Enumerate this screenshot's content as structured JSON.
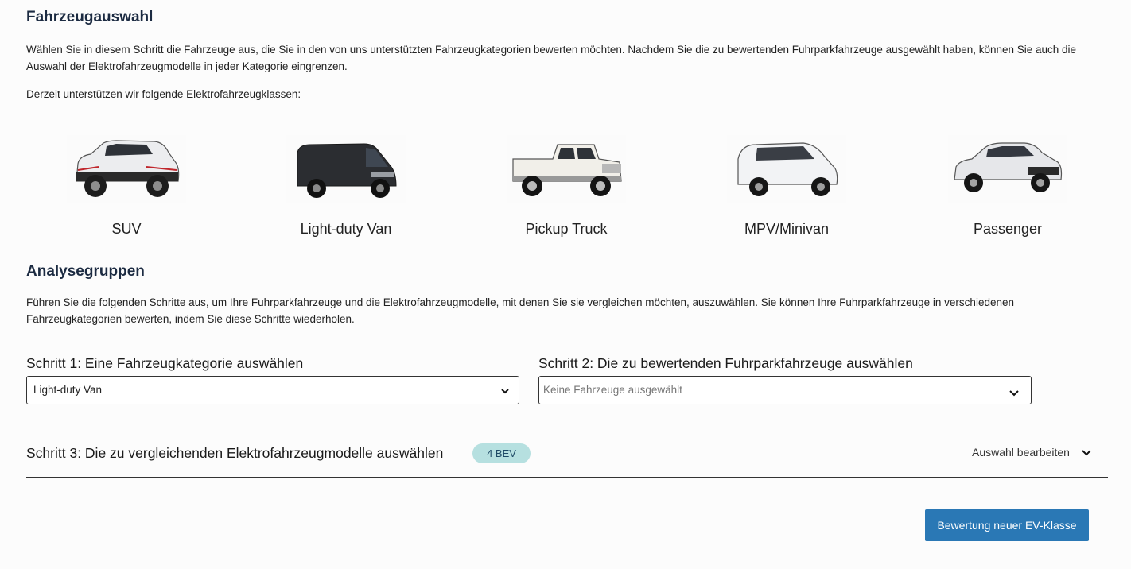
{
  "vehicle_selection": {
    "title": "Fahrzeugauswahl",
    "intro": "Wählen Sie in diesem Schritt die Fahrzeuge aus, die Sie in den von uns unterstützten Fahrzeugkategorien bewerten möchten. Nachdem Sie die zu bewertenden Fuhrparkfahrzeuge ausgewählt haben, können Sie auch die Auswahl der Elektrofahrzeugmodelle in jeder Kategorie eingrenzen.",
    "supported_text": "Derzeit unterstützen wir folgende Elektrofahrzeugklassen:",
    "classes": [
      {
        "label": "SUV",
        "icon": "suv-car-image"
      },
      {
        "label": "Light-duty Van",
        "icon": "van-image"
      },
      {
        "label": "Pickup Truck",
        "icon": "pickup-truck-image"
      },
      {
        "label": "MPV/Minivan",
        "icon": "minivan-image"
      },
      {
        "label": "Passenger",
        "icon": "sedan-image"
      }
    ]
  },
  "analysis_groups": {
    "title": "Analysegruppen",
    "intro": "Führen Sie die folgenden Schritte aus, um Ihre Fuhrparkfahrzeuge und die Elektrofahrzeugmodelle, mit denen Sie sie vergleichen möchten, auszuwählen. Sie können Ihre Fuhrparkfahrzeuge in verschiedenen Fahrzeugkategorien bewerten, indem Sie diese Schritte wiederholen.",
    "step1": {
      "label": "Schritt 1: Eine Fahrzeugkategorie auswählen",
      "value": "Light-duty Van"
    },
    "step2": {
      "label": "Schritt 2: Die zu bewertenden Fuhrparkfahrzeuge auswählen",
      "placeholder": "Keine Fahrzeuge ausgewählt"
    },
    "step3": {
      "label": "Schritt 3: Die zu vergleichenden Elektrofahrzeugmodelle auswählen",
      "badge": "4 BEV",
      "edit_label": "Auswahl bearbeiten"
    }
  },
  "actions": {
    "new_class_button": "Bewertung neuer EV-Klasse"
  },
  "colors": {
    "heading": "#1c2b42",
    "badge_bg": "#b6e0e0",
    "button_bg": "#2a78b5"
  }
}
